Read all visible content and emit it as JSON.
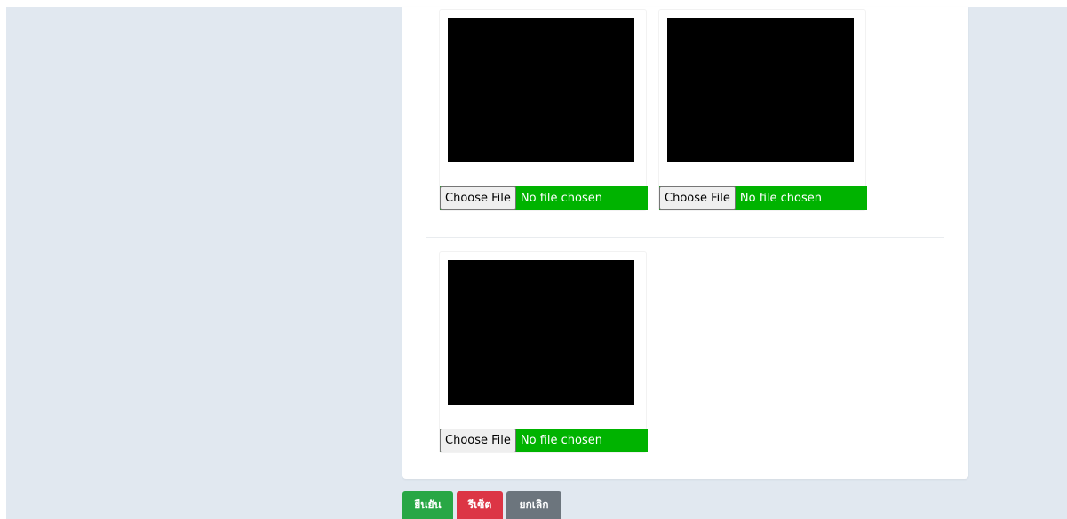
{
  "uploads": [
    {
      "choose_label": "Choose File",
      "status": "No file chosen"
    },
    {
      "choose_label": "Choose File",
      "status": "No file chosen"
    },
    {
      "choose_label": "Choose File",
      "status": "No file chosen"
    }
  ],
  "actions": {
    "confirm_label": "ยืนยัน",
    "reset_label": "รีเซ็ต",
    "cancel_label": "ยกเลิก"
  },
  "colors": {
    "page_background": "#e1e8f0",
    "file_row_background": "#00b300",
    "preview": "#000000",
    "confirm": "#28a745",
    "reset": "#dc3545",
    "cancel": "#6c757d"
  }
}
